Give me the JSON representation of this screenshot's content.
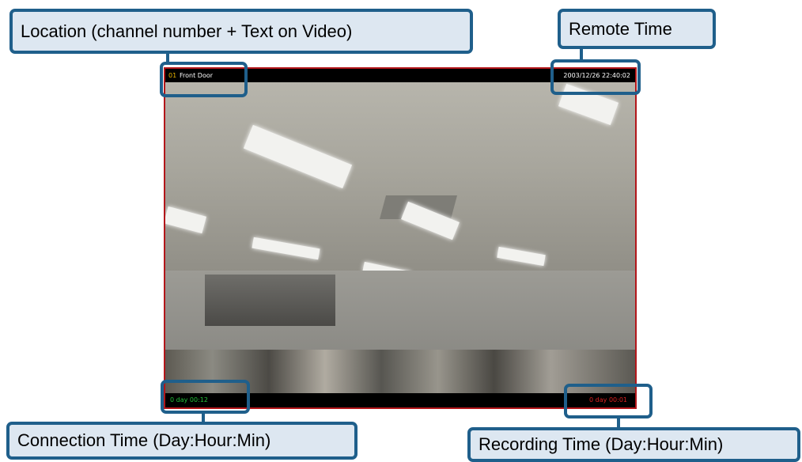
{
  "callouts": {
    "location": "Location (channel number + Text on Video)",
    "remote_time": "Remote Time",
    "connection_time": "Connection Time (Day:Hour:Min)",
    "recording_time": "Recording Time (Day:Hour:Min)"
  },
  "video": {
    "channel_number": "01",
    "location_text": "Front Door",
    "remote_time": "2003/12/26 22:40:02",
    "connection_time": "0 day  00:12",
    "recording_time": "0 day  00:01"
  },
  "colors": {
    "callout_border": "#1f5f8b",
    "callout_fill": "#dde7f1",
    "video_border": "#b3161a",
    "channel_number": "#e8b400",
    "connection_time": "#22c43a",
    "recording_time": "#e02020"
  }
}
